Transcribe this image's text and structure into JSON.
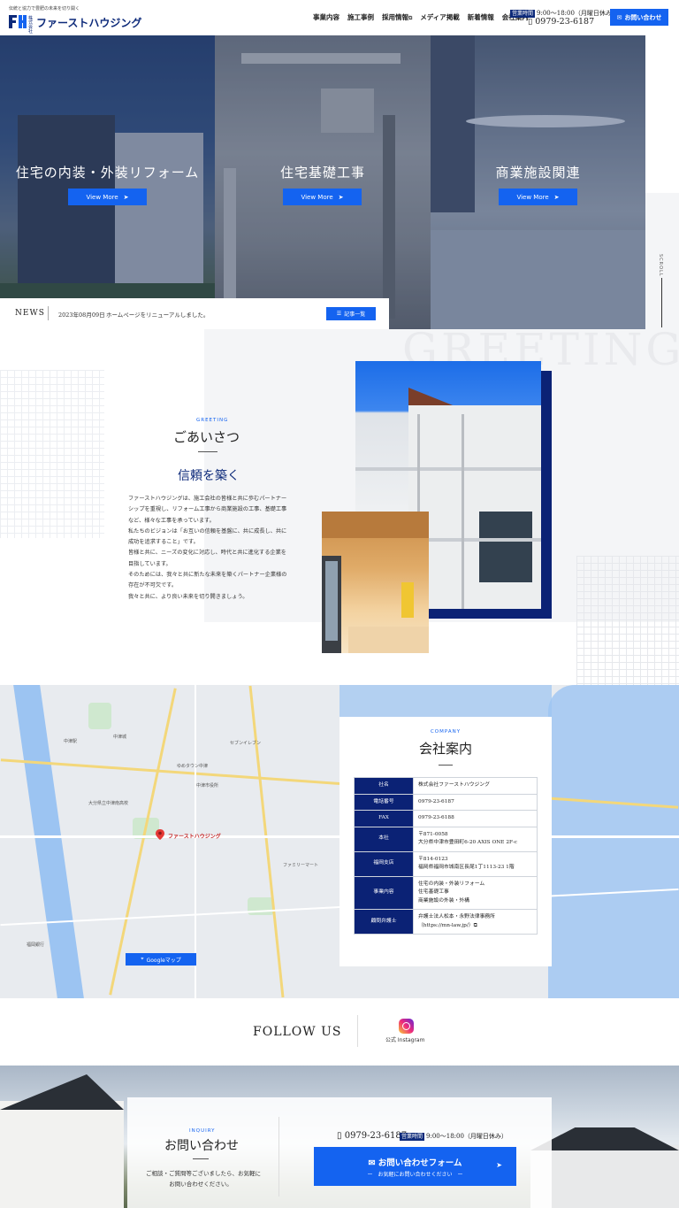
{
  "header": {
    "tagline": "伝統と協力で豊肥の未来を切り開く",
    "logo_small": "株式会社",
    "logo_name": "ファーストハウジング",
    "nav": [
      "事業内容",
      "施工事例",
      "採用情報",
      "メディア掲載",
      "新着情報",
      "会社案内"
    ],
    "hours_badge": "営業時間",
    "hours": "9:00～18:00（月曜日休み）",
    "phone": "0979-23-6187",
    "contact": "お問い合わせ",
    "accent": "#1463f0",
    "navy": "#0d2a7a"
  },
  "hero": {
    "panels": [
      {
        "title": "住宅の内装・外装リフォーム",
        "button": "View More"
      },
      {
        "title": "住宅基礎工事",
        "button": "View More"
      },
      {
        "title": "商業施設関連",
        "button": "View More"
      }
    ],
    "rail_label": "SCROLL"
  },
  "news": {
    "label": "NEWS",
    "date": "2023年08月09日",
    "text": "ホームページをリニューアルしました。",
    "button": "記事一覧"
  },
  "greeting": {
    "bg_word": "GREETING",
    "sub": "GREETING",
    "title": "ごあいさつ",
    "lead": "信頼を築く",
    "body": [
      "ファーストハウジングは、施工会社の皆様と共に歩むパートナー",
      "シップを重視し、リフォーム工事から商業施設の工事、基礎工事",
      "など、様々な工事を承っています。",
      "私たちのビジョンは「お互いの信頼を基盤に、共に成長し、共に",
      "成功を追求すること」です。",
      "皆様と共に、ニーズの変化に対応し、時代と共に進化する企業を",
      "目指しています。",
      "そのためには、我々と共に新たな未来を築くパートナー企業様の",
      "存在が不可欠です。",
      "我々と共に、より良い未来を切り開きましょう。"
    ]
  },
  "map": {
    "pin_label": "ファーストハウジング",
    "button": "Googleマップ",
    "labels": [
      "中津城",
      "中津駅",
      "中津市役所",
      "大分県立中津南高校",
      "ゆめタウン中津",
      "セブンイレブン",
      "ファミリーマート",
      "福岡銀行"
    ]
  },
  "company": {
    "sub": "COMPANY",
    "title": "会社案内",
    "rows": [
      {
        "label": "社名",
        "value": [
          "株式会社ファーストハウジング"
        ]
      },
      {
        "label": "電話番号",
        "value": [
          "0979-23-6187"
        ]
      },
      {
        "label": "FAX",
        "value": [
          "0979-23-6188"
        ]
      },
      {
        "label": "本社",
        "value": [
          "〒871-0058",
          "大分県中津市豊田町6-20 AXIS ONE 2F-c"
        ]
      },
      {
        "label": "福岡支店",
        "value": [
          "〒814-0123",
          "福岡県福岡市城南区長尾1丁1113-23 1階"
        ]
      },
      {
        "label": "事業内容",
        "value": [
          "住宅の内装・外装リフォーム",
          "住宅基礎工事",
          "商業施設の外装・外構"
        ]
      },
      {
        "label": "顧問弁護士",
        "value": [
          "弁護士法人松本・永野法律事務所",
          "（https://mn-law.jp/）"
        ]
      }
    ]
  },
  "follow": {
    "title": "FOLLOW US",
    "instagram": "公式 Instagram"
  },
  "inquiry": {
    "sub": "INQUIRY",
    "title": "お問い合わせ",
    "body": [
      "ご相談・ご質問等ございましたら、お気軽に",
      "お問い合わせください。"
    ],
    "phone": "0979-23-6187",
    "hours_badge": "営業時間",
    "hours": "9:00～18:00（月曜日休み）",
    "button": "お問い合わせフォーム",
    "button_sub": "ー　お気軽にお問い合わせください　ー"
  }
}
